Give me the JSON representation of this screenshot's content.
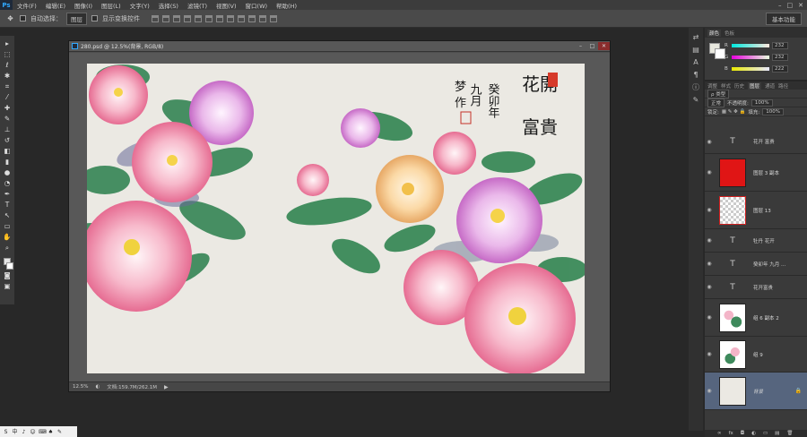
{
  "menubar": {
    "logo": "Ps",
    "items": [
      "文件(F)",
      "编辑(E)",
      "图像(I)",
      "图层(L)",
      "文字(Y)",
      "选择(S)",
      "滤镜(T)",
      "视图(V)",
      "窗口(W)",
      "帮助(H)"
    ],
    "window_buttons": [
      "–",
      "□",
      "✕"
    ]
  },
  "options": {
    "auto_select_label": "自动选择：",
    "auto_select_value": "图层",
    "show_transform_label": "显示变换控件",
    "workspace": "基本功能"
  },
  "document": {
    "title": "280.psd @ 12.5%(背景, RGB/8)",
    "zoom": "12.5%",
    "doc_size": "文档:159.7M/262.1M",
    "window_buttons": [
      "–",
      "□",
      "✕"
    ],
    "artwork": {
      "calligraphy_title": [
        "花開",
        "富貴"
      ],
      "calligraphy_date": [
        "癸卯年",
        "九月"
      ],
      "calligraphy_author": [
        "梦",
        "作"
      ]
    }
  },
  "panels": {
    "color_tabs": [
      "颜色",
      "色板"
    ],
    "color": {
      "r_label": "R",
      "r_value": "232",
      "g_label": "G",
      "g_value": "232",
      "b_label": "B",
      "b_value": "222",
      "fg_color": "#e8e8de",
      "bg_color": "#ffffff"
    },
    "layer_tabs": [
      "调整",
      "样式",
      "历史",
      "图层",
      "通道",
      "路径"
    ],
    "active_layer_tab": "图层",
    "layer_kind": "ρ 类型",
    "blend_mode": "正常",
    "opacity_label": "不透明度:",
    "opacity_value": "100%",
    "lock_label": "锁定:",
    "fill_label": "填充:",
    "fill_value": "100%",
    "layers": [
      {
        "name": "花开 富贵",
        "type": "text"
      },
      {
        "name": "图层 3 副本",
        "type": "red"
      },
      {
        "name": "图层 13",
        "type": "frame"
      },
      {
        "name": "牡丹 花开",
        "type": "text"
      },
      {
        "name": "癸卯年 九月 ...",
        "type": "text"
      },
      {
        "name": "花开富贵",
        "type": "text"
      },
      {
        "name": "组 6 副本 2",
        "type": "group"
      },
      {
        "name": "组 9",
        "type": "group"
      },
      {
        "name": "背景",
        "type": "bg"
      }
    ],
    "footer_icons": [
      "∞",
      "fx",
      "◘",
      "◐",
      "▭",
      "▤",
      "🗑"
    ]
  },
  "taskbar": {
    "items": [
      "S",
      "中",
      "♪",
      "☺",
      "⌨",
      "♠",
      "✎"
    ]
  }
}
